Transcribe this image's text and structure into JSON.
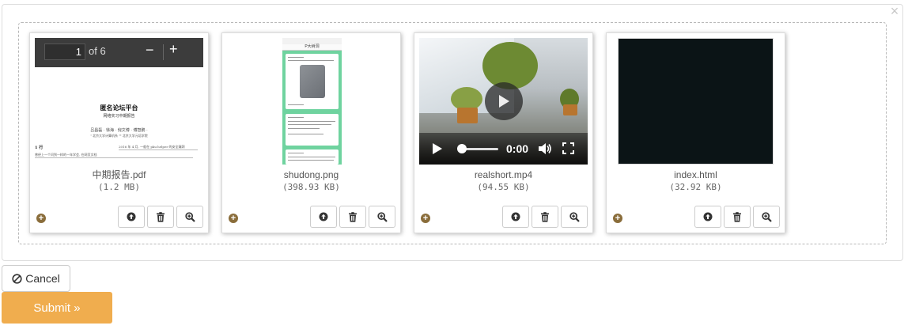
{
  "files": [
    {
      "name": "中期报告.pdf",
      "size": "(1.2 MB)",
      "kind": "pdf",
      "pdf_viewer": {
        "page": "1",
        "of_label": "of 6",
        "minus": "−",
        "plus": "+"
      },
      "page_text": {
        "title": "匿名论坛平台",
        "subtitle": "网络实习中期报告",
        "authors": "吕昌磊 · 徐海 · 倪文博 · 傅智鹏 ·",
        "affiliation": "¹ 北京大学计算机系  ²² 北京大学元培学院",
        "section": "1 行",
        "body1": "2016 年 4 月, 一般在 pku helper 的安全漏洞",
        "body2": "曾经上一个问到一样的一年学会, 在网页文档"
      }
    },
    {
      "name": "shudong.png",
      "size": "(398.93 KB)",
      "kind": "image",
      "phone_title": "P大树洞"
    },
    {
      "name": "realshort.mp4",
      "size": "(94.55 KB)",
      "kind": "video",
      "time": "0:00"
    },
    {
      "name": "index.html",
      "size": "(32.92 KB)",
      "kind": "html"
    }
  ],
  "icons": {
    "close": "close-icon",
    "add": "plus-circle-icon",
    "upload": "upload-circle-icon",
    "delete": "trash-icon",
    "zoom": "zoom-in-icon",
    "cancel": "ban-icon"
  },
  "close_glyph": "×",
  "add_glyph": "+",
  "buttons": {
    "cancel_label": "Cancel",
    "submit_label": "Submit »"
  },
  "colors": {
    "submit_bg": "#f0ad4e",
    "add_icon": "#8a6d3b",
    "pdf_toolbar": "#3c3c3c"
  }
}
